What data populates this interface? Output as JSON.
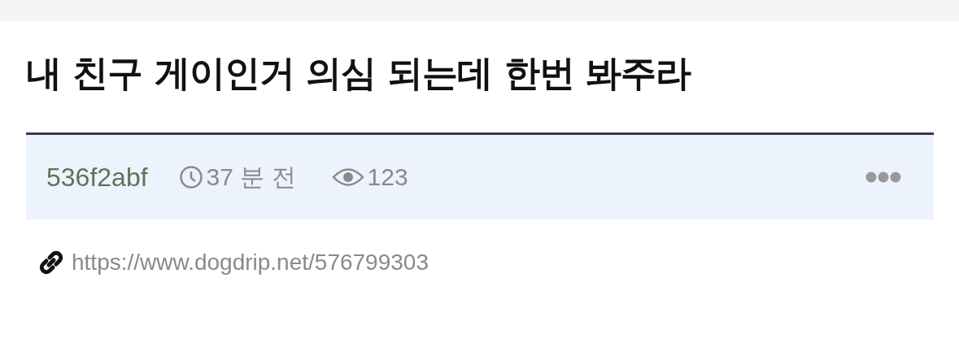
{
  "post": {
    "title": "내 친구 게이인거 의심 되는데 한번 봐주라",
    "author": "536f2abf",
    "time": "37 분 전",
    "views": "123",
    "url": "https://www.dogdrip.net/576799303"
  }
}
